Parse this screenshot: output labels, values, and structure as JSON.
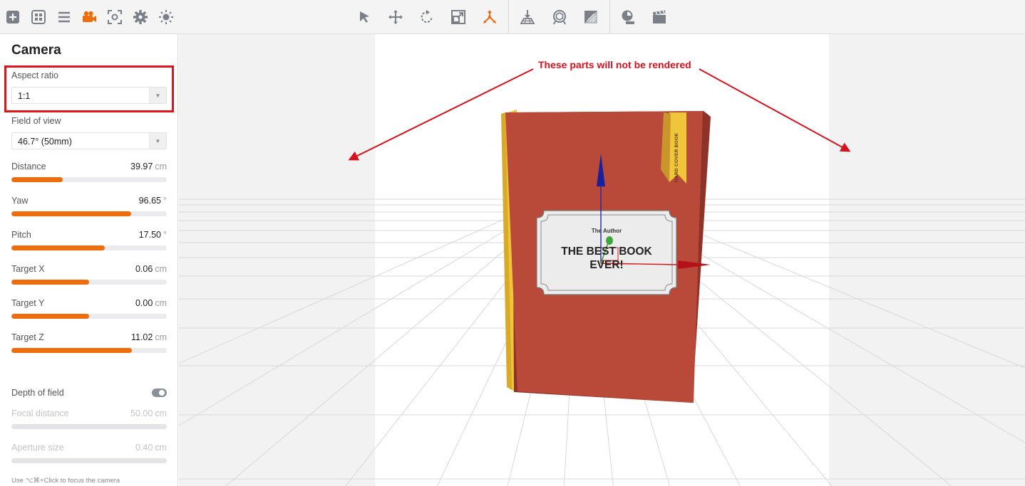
{
  "toolbar": {
    "left_icons": [
      "add-icon",
      "grid-icon",
      "menu-icon",
      "camera-icon",
      "focus-icon",
      "gear-icon",
      "light-icon"
    ],
    "active_icon": "camera-icon",
    "center_icons": [
      "select-arrow-icon",
      "move-icon",
      "rotate-icon",
      "scale-icon",
      "pivot-icon"
    ],
    "right_icons": [
      "ground-icon",
      "view-icon",
      "material-icon"
    ],
    "far_right_icons": [
      "timer-icon",
      "clapper-icon"
    ]
  },
  "panel": {
    "title": "Camera",
    "aspect_ratio": {
      "label": "Aspect ratio",
      "value": "1:1"
    },
    "field_of_view": {
      "label": "Field of view",
      "value": "46.7° (50mm)"
    },
    "sliders": [
      {
        "label": "Distance",
        "value": "39.97",
        "unit": "cm",
        "fill": 0.33
      },
      {
        "label": "Yaw",
        "value": "96.65",
        "unit": "°",
        "fill": 0.77
      },
      {
        "label": "Pitch",
        "value": "17.50",
        "unit": "°",
        "fill": 0.6
      },
      {
        "label": "Target X",
        "value": "0.06",
        "unit": "cm",
        "fill": 0.5
      },
      {
        "label": "Target Y",
        "value": "0.00",
        "unit": "cm",
        "fill": 0.5
      },
      {
        "label": "Target Z",
        "value": "11.02",
        "unit": "cm",
        "fill": 0.775
      }
    ],
    "depth_of_field": {
      "label": "Depth of field",
      "enabled": false
    },
    "focal_distance": {
      "label": "Focal distance",
      "value": "50.00",
      "unit": "cm",
      "fill": 0
    },
    "aperture_size": {
      "label": "Aperture size",
      "value": "0.40",
      "unit": "cm",
      "fill": 0
    },
    "hint": "Use ⌥⌘+Click to focus the camera"
  },
  "viewport": {
    "annotation": "These parts will not be rendered",
    "book": {
      "author": "The Author",
      "title_line1": "THE BEST BOOK",
      "title_line2": "EVER!",
      "ribbon_text": "HARD COVER BOOK"
    }
  },
  "colors": {
    "accent": "#ef6c0c",
    "annotation": "#d8121c",
    "book_cover": "#b94a3a",
    "book_spine": "#e8c13a"
  }
}
